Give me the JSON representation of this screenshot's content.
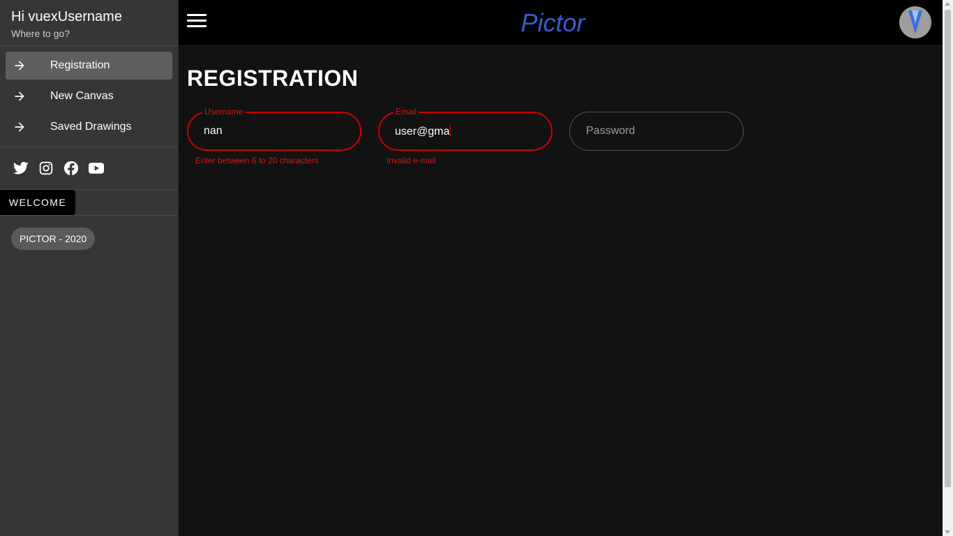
{
  "sidebar": {
    "greeting": "Hi vuexUsername",
    "subtitle": "Where to go?",
    "nav": [
      {
        "label": "Registration",
        "icon": "arrow-right-icon",
        "active": true
      },
      {
        "label": "New Canvas",
        "icon": "arrow-right-icon",
        "active": false
      },
      {
        "label": "Saved Drawings",
        "icon": "arrow-right-icon",
        "active": false
      }
    ],
    "social": [
      "twitter-icon",
      "instagram-icon",
      "facebook-icon",
      "youtube-icon"
    ],
    "welcome_label": "WELCOME",
    "footer_chip": "PICTOR - 2020"
  },
  "topbar": {
    "brand": "Pictor",
    "brand_color": "#3b5bd0"
  },
  "main": {
    "title": "REGISTRATION",
    "fields": {
      "username": {
        "label": "Username",
        "value": "nan",
        "error": "Enter between 6 to 20 characters"
      },
      "email": {
        "label": "Email",
        "value": "user@gma",
        "error": "Invalid e-mail"
      },
      "password": {
        "placeholder": "Password",
        "value": ""
      }
    },
    "error_color": "#d00000"
  }
}
